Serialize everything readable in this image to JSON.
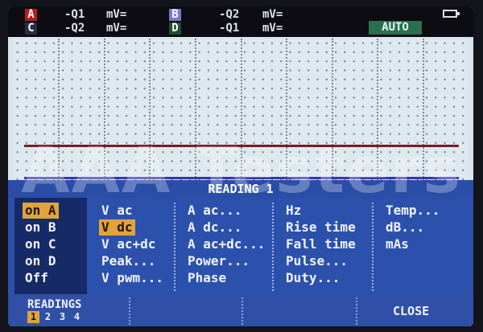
{
  "header": {
    "channels": [
      {
        "tag": "A",
        "value": "-Q1",
        "unit": "mV="
      },
      {
        "tag": "B",
        "value": "-Q2",
        "unit": "mV="
      },
      {
        "tag": "C",
        "value": "-Q2",
        "unit": "mV="
      },
      {
        "tag": "D",
        "value": "-Q1",
        "unit": "mV="
      }
    ],
    "mode": "AUTO",
    "battery_icon": "battery-icon"
  },
  "menu": {
    "title": "READING 1",
    "source": [
      "on A",
      "on B",
      "on C",
      "on D",
      "Off"
    ],
    "source_selected": "on A",
    "voltage": [
      "V ac",
      "V dc",
      "V ac+dc",
      "Peak...",
      "V pwm..."
    ],
    "voltage_selected": "V dc",
    "current": [
      "A ac...",
      "A dc...",
      "A ac+dc...",
      "Power...",
      "Phase"
    ],
    "timing": [
      "Hz",
      "Rise time",
      "Fall time",
      "Pulse...",
      "Duty..."
    ],
    "other": [
      "Temp...",
      "dB...",
      "mAs"
    ]
  },
  "footer": {
    "readings_label": "READINGS",
    "pages": [
      "1",
      "2",
      "3",
      "4"
    ],
    "active_page": "1",
    "close_label": "CLOSE"
  },
  "watermark": "AAA Testers",
  "colors": {
    "trace_a": "#7c1a22",
    "trace_b": "#3a36a8",
    "highlight": "#e0a43a",
    "menu_bg": "#2c51ad"
  }
}
